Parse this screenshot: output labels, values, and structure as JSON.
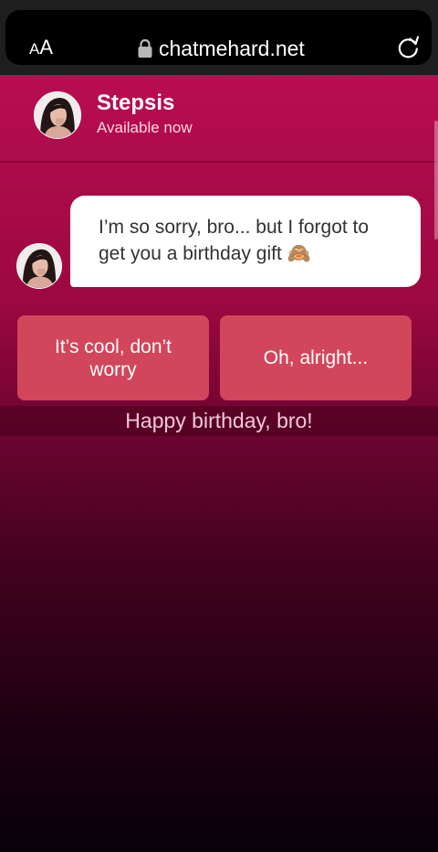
{
  "browser": {
    "text_size_label_small": "A",
    "text_size_label_large": "A",
    "url": "chatmehard.net",
    "lock_icon": "lock-icon",
    "reload_icon": "reload-icon"
  },
  "chat": {
    "contact_name": "Stepsis",
    "contact_status": "Available now",
    "messages": [
      {
        "sender": "Stepsis",
        "text": "I’m so sorry, bro... but I forgot to get you a birthday gift 🙈"
      }
    ],
    "replies": [
      {
        "label": "It’s cool, don’t worry"
      },
      {
        "label": "Oh, alright..."
      }
    ]
  },
  "subtitle": "Happy birthday, bro!",
  "colors": {
    "accent": "#c40f55",
    "reply_button": "#d1465b",
    "bubble": "#ffffff"
  }
}
